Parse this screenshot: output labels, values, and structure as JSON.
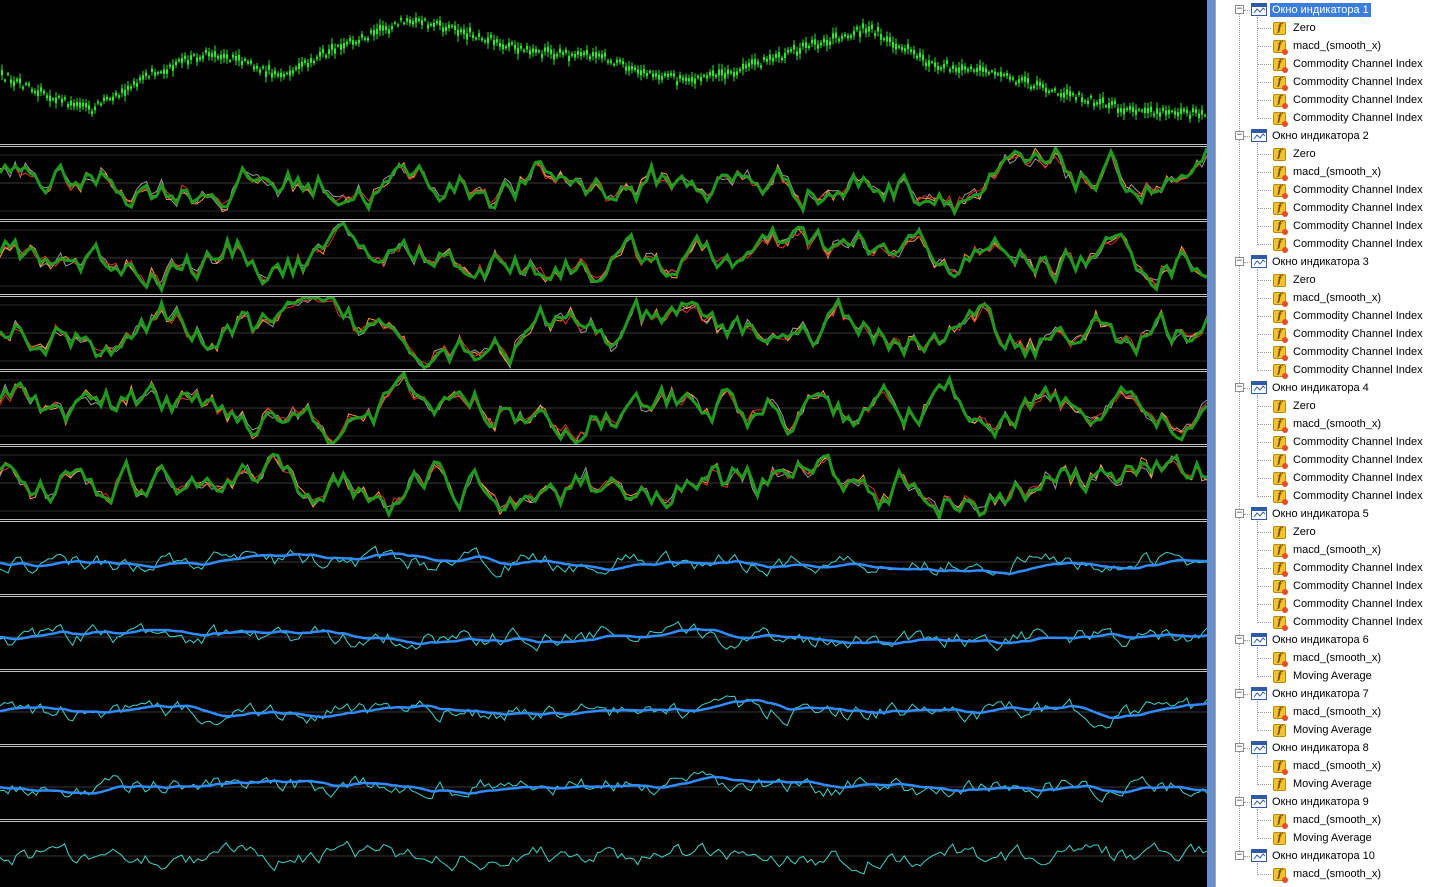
{
  "colors": {
    "price": "#22ee22",
    "cci_thick": "#1f9a1f",
    "cci_red": "#e03020",
    "cci_orange": "#ff9a3a",
    "cci_gray": "#9a9a9a",
    "macd_thin": "#3fd3c8",
    "ma_blue": "#2f8cff",
    "selection": "#3b7ddd",
    "splitter": "#6a8fc8"
  },
  "tree": {
    "windows": [
      {
        "label": "Окно индикатора 1",
        "selected": true,
        "items": [
          "Zero",
          "macd_(smooth_x)",
          "Commodity Channel Index",
          "Commodity Channel Index",
          "Commodity Channel Index",
          "Commodity Channel Index"
        ]
      },
      {
        "label": "Окно индикатора 2",
        "selected": false,
        "items": [
          "Zero",
          "macd_(smooth_x)",
          "Commodity Channel Index",
          "Commodity Channel Index",
          "Commodity Channel Index",
          "Commodity Channel Index"
        ]
      },
      {
        "label": "Окно индикатора 3",
        "selected": false,
        "items": [
          "Zero",
          "macd_(smooth_x)",
          "Commodity Channel Index",
          "Commodity Channel Index",
          "Commodity Channel Index",
          "Commodity Channel Index"
        ]
      },
      {
        "label": "Окно индикатора 4",
        "selected": false,
        "items": [
          "Zero",
          "macd_(smooth_x)",
          "Commodity Channel Index",
          "Commodity Channel Index",
          "Commodity Channel Index",
          "Commodity Channel Index"
        ]
      },
      {
        "label": "Окно индикатора 5",
        "selected": false,
        "items": [
          "Zero",
          "macd_(smooth_x)",
          "Commodity Channel Index",
          "Commodity Channel Index",
          "Commodity Channel Index",
          "Commodity Channel Index"
        ]
      },
      {
        "label": "Окно индикатора 6",
        "selected": false,
        "items": [
          "macd_(smooth_x)",
          "Moving Average"
        ]
      },
      {
        "label": "Окно индикатора 7",
        "selected": false,
        "items": [
          "macd_(smooth_x)",
          "Moving Average"
        ]
      },
      {
        "label": "Окно индикатора 8",
        "selected": false,
        "items": [
          "macd_(smooth_x)",
          "Moving Average"
        ]
      },
      {
        "label": "Окно индикатора 9",
        "selected": false,
        "items": [
          "macd_(smooth_x)",
          "Moving Average"
        ]
      },
      {
        "label": "Окно индикатора 10",
        "selected": false,
        "items": [
          "macd_(smooth_x)"
        ]
      }
    ]
  }
}
